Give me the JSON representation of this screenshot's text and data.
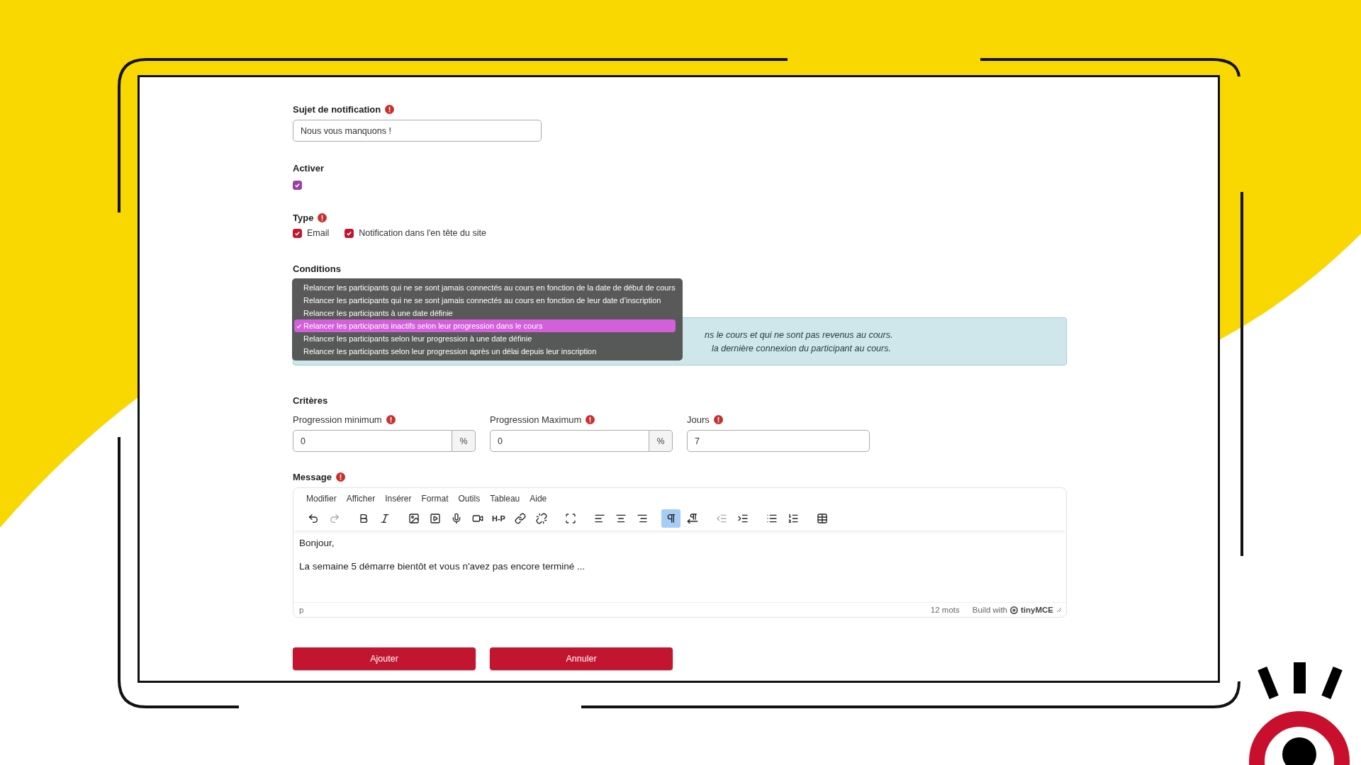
{
  "subject": {
    "label": "Sujet de notification",
    "required": true,
    "value": "Nous vous manquons !"
  },
  "activate": {
    "label": "Activer",
    "checked": true
  },
  "type": {
    "label": "Type",
    "required": true,
    "options": [
      {
        "label": "Email",
        "checked": true
      },
      {
        "label": "Notification dans l'en tête du site",
        "checked": true
      }
    ]
  },
  "conditions": {
    "label": "Conditions",
    "options": [
      {
        "label": "Relancer les participants qui ne se sont jamais connectés au cours en fonction de la date de début de cours",
        "selected": false
      },
      {
        "label": "Relancer les participants qui ne se sont jamais connectés au cours en fonction de leur date d’inscription",
        "selected": false
      },
      {
        "label": "Relancer les participants à une date définie",
        "selected": false
      },
      {
        "label": "Relancer les participants inactifs selon leur progression dans le cours",
        "selected": true
      },
      {
        "label": "Relancer les participants selon leur progression à une date définie",
        "selected": false
      },
      {
        "label": "Relancer les participants selon leur progression après un délai depuis leur inscription",
        "selected": false
      }
    ],
    "info_lines": [
      "ns le cours et qui ne sont pas revenus au cours.",
      "la dernière connexion du participant au cours."
    ]
  },
  "criteria": {
    "label": "Critères",
    "fields": [
      {
        "label": "Progression minimum",
        "required": true,
        "value": "0",
        "unit": "%"
      },
      {
        "label": "Progression Maximum",
        "required": true,
        "value": "0",
        "unit": "%"
      },
      {
        "label": "Jours",
        "required": true,
        "value": "7"
      }
    ]
  },
  "message": {
    "label": "Message",
    "required": true,
    "menu": [
      "Modifier",
      "Afficher",
      "Insérer",
      "Format",
      "Outils",
      "Tableau",
      "Aide"
    ],
    "toolbar": [
      {
        "items": [
          {
            "kind": "icon",
            "active": false,
            "disabled": false
          },
          {
            "kind": "icon",
            "active": false,
            "disabled": true
          }
        ]
      },
      {
        "items": [
          {
            "kind": "icon",
            "active": false,
            "disabled": false
          },
          {
            "kind": "icon",
            "active": false,
            "disabled": false
          }
        ]
      },
      {
        "items": [
          {
            "kind": "icon",
            "active": false,
            "disabled": false
          },
          {
            "kind": "icon",
            "active": false,
            "disabled": false
          },
          {
            "kind": "icon",
            "active": false,
            "disabled": false
          },
          {
            "kind": "icon",
            "active": false,
            "disabled": false
          },
          {
            "kind": "text",
            "label": "H-P",
            "active": false,
            "disabled": false
          },
          {
            "kind": "icon",
            "active": false,
            "disabled": false
          },
          {
            "kind": "icon",
            "active": false,
            "disabled": false
          }
        ]
      },
      {
        "items": [
          {
            "kind": "icon",
            "active": false,
            "disabled": false
          }
        ]
      },
      {
        "items": [
          {
            "kind": "icon",
            "active": false,
            "disabled": false
          },
          {
            "kind": "icon",
            "active": false,
            "disabled": false
          },
          {
            "kind": "icon",
            "active": false,
            "disabled": false
          }
        ]
      },
      {
        "items": [
          {
            "kind": "icon",
            "active": true,
            "disabled": false
          },
          {
            "kind": "icon",
            "active": false,
            "disabled": false
          }
        ]
      },
      {
        "items": [
          {
            "kind": "icon",
            "active": false,
            "disabled": true
          },
          {
            "kind": "icon",
            "active": false,
            "disabled": false
          }
        ]
      },
      {
        "items": [
          {
            "kind": "icon",
            "active": false,
            "disabled": false
          },
          {
            "kind": "icon",
            "active": false,
            "disabled": false
          }
        ]
      },
      {
        "items": [
          {
            "kind": "icon",
            "active": false,
            "disabled": false
          }
        ]
      }
    ],
    "paragraphs": [
      "Bonjour,",
      "La semaine 5 démarre bientôt et vous n'avez pas encore terminé ..."
    ],
    "status": {
      "path": "p",
      "word_count": "12 mots",
      "branding": "Build with",
      "brand": "tinyMCE"
    }
  },
  "buttons": [
    {
      "label": "Ajouter"
    },
    {
      "label": "Annuler"
    }
  ]
}
